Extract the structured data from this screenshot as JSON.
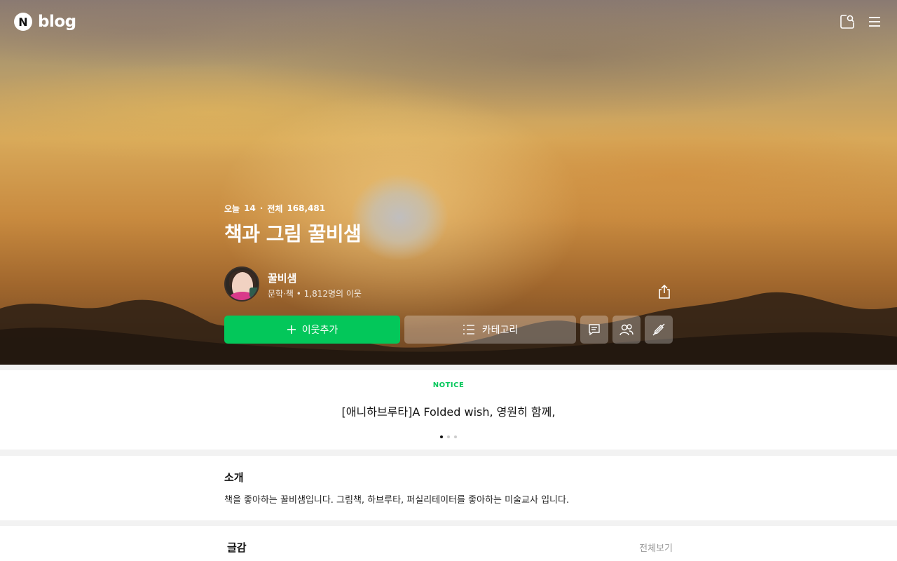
{
  "header": {
    "logo_mark": "N",
    "logo_text": "blog",
    "icons": [
      "notification-search-icon",
      "menu-icon"
    ]
  },
  "hero": {
    "today_label": "오늘",
    "today_count": "14",
    "separator": "·",
    "total_label": "전체",
    "total_count": "168,481",
    "blog_title": "책과 그림 꿀비샘"
  },
  "profile": {
    "name": "꿀비샘",
    "meta": "문학·책 • 1,812명의 이웃"
  },
  "actions": {
    "follow_label": "이웃추가",
    "category_label": "카테고리",
    "icons": [
      "chat-icon",
      "neighbors-icon",
      "write-off-icon"
    ]
  },
  "notice": {
    "label": "NOTICE",
    "text": "[애니하브루타]A Folded wish, 영원히 함께,",
    "pages": 3,
    "active_page": 1
  },
  "intro": {
    "title": "소개",
    "text": "책을 좋아하는 꿀비샘입니다. 그림책, 하브루타, 퍼실리테이터를 좋아하는 미술교사 입니다."
  },
  "posts": {
    "title": "글감",
    "view_all": "전체보기"
  },
  "colors": {
    "accent_green": "#03c75a",
    "notice_label": "#03c75a"
  }
}
